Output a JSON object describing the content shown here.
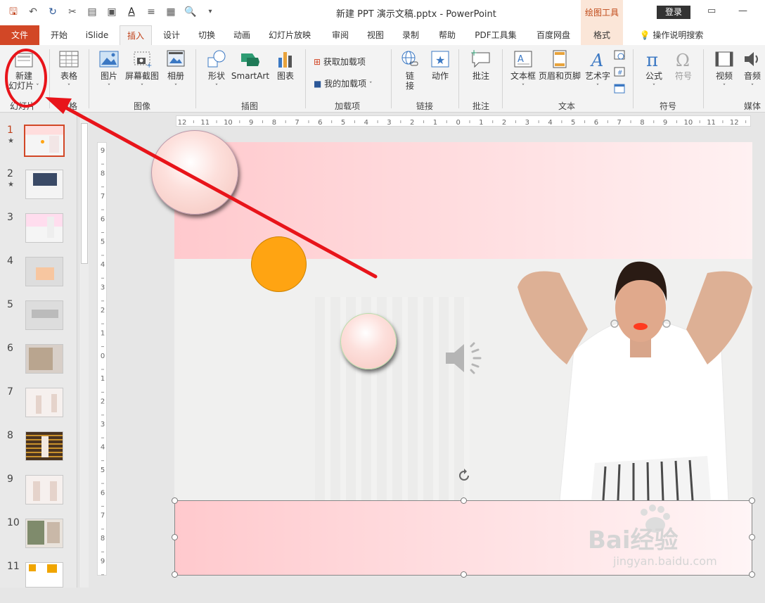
{
  "titlebar": {
    "title": "新建 PPT 演示文稿.pptx  -  PowerPoint",
    "context_tool": "绘图工具",
    "login": "登录"
  },
  "tabs": [
    {
      "label": "文件"
    },
    {
      "label": "开始"
    },
    {
      "label": "iSlide"
    },
    {
      "label": "插入"
    },
    {
      "label": "设计"
    },
    {
      "label": "切换"
    },
    {
      "label": "动画"
    },
    {
      "label": "幻灯片放映"
    },
    {
      "label": "审阅"
    },
    {
      "label": "视图"
    },
    {
      "label": "录制"
    },
    {
      "label": "帮助"
    },
    {
      "label": "PDF工具集"
    },
    {
      "label": "百度网盘"
    },
    {
      "label": "格式"
    }
  ],
  "search_hint": "操作说明搜索",
  "ribbon": {
    "new_slide_line1": "新建",
    "new_slide_line2": "幻灯片",
    "table": "表格",
    "picture": "图片",
    "screenshot": "屏幕截图",
    "album": "相册",
    "shapes": "形状",
    "smartart": "SmartArt",
    "chart": "图表",
    "get_addins": "获取加载项",
    "my_addins": "我的加载项",
    "link_line1": "链",
    "link_line2": "接",
    "action": "动作",
    "comment": "批注",
    "textbox": "文本框",
    "header_footer": "页眉和页脚",
    "wordart": "艺术字",
    "equation": "公式",
    "symbol": "符号",
    "video": "视频",
    "audio": "音频",
    "groups": {
      "slides": "幻灯片",
      "tables": "表格",
      "images": "图像",
      "illustrations": "插图",
      "addins": "加载项",
      "links": "链接",
      "comments": "批注",
      "text": "文本",
      "symbols": "符号",
      "media": "媒体"
    }
  },
  "slides": [
    {
      "num": "1",
      "star": "★"
    },
    {
      "num": "2",
      "star": "★"
    },
    {
      "num": "3",
      "star": ""
    },
    {
      "num": "4",
      "star": ""
    },
    {
      "num": "5",
      "star": ""
    },
    {
      "num": "6",
      "star": ""
    },
    {
      "num": "7",
      "star": ""
    },
    {
      "num": "8",
      "star": ""
    },
    {
      "num": "9",
      "star": ""
    },
    {
      "num": "10",
      "star": ""
    },
    {
      "num": "11",
      "star": ""
    }
  ],
  "hruler_labels": [
    "12",
    "11",
    "10",
    "9",
    "8",
    "7",
    "6",
    "5",
    "4",
    "3",
    "2",
    "1",
    "0",
    "1",
    "2",
    "3",
    "4",
    "5",
    "6",
    "7",
    "8",
    "9",
    "10",
    "11",
    "12"
  ],
  "vruler_labels": [
    "9",
    "8",
    "7",
    "6",
    "5",
    "4",
    "3",
    "2",
    "1",
    "0",
    "1",
    "2",
    "3",
    "4",
    "5",
    "6",
    "7",
    "8",
    "9"
  ],
  "watermark": {
    "brand": "Bai经验",
    "url": "jingyan.baidu.com"
  },
  "colors": {
    "accent": "#d24726",
    "annotation": "#e8141a",
    "orange_circle": "#ffa412",
    "pink_circle": "#fcd8d4"
  }
}
